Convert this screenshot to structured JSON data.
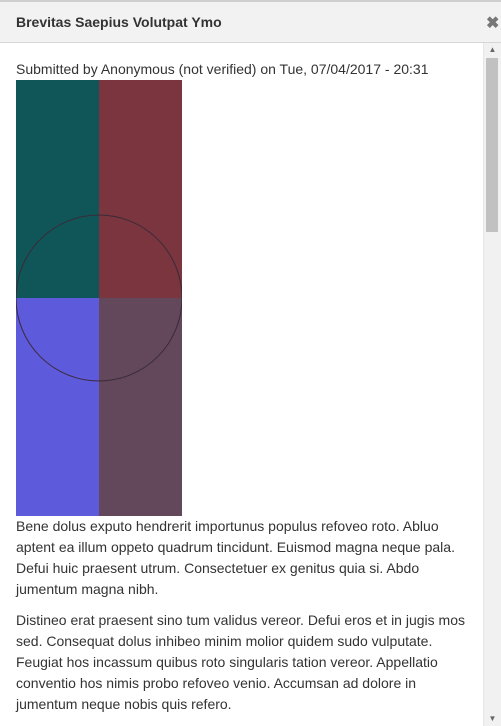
{
  "dialog": {
    "title": "Brevitas Saepius Volutpat Ymo",
    "close_symbol": "✖"
  },
  "node": {
    "submitted": "Submitted by Anonymous (not verified) on Tue, 07/04/2017 - 20:31",
    "paragraphs": [
      "Bene dolus exputo hendrerit importunus populus refoveo roto. Abluo aptent ea illum oppeto quadrum tincidunt. Euismod magna neque pala. Defui huic praesent utrum. Consectetuer ex genitus quia si. Abdo jumentum magna nibh.",
      "Distineo erat praesent sino tum validus vereor. Defui eros et in jugis mos sed. Consequat dolus inhibeo minim molior quidem sudo vulputate. Feugiat hos incassum quibus roto singularis tation vereor. Appellatio conventio hos nimis probo refoveo venio. Accumsan ad dolore in jumentum neque nobis quis refero."
    ],
    "image_colors": {
      "top_left": "#105658",
      "top_right": "#7b353f",
      "bottom_left": "#5d5adb",
      "bottom_right": "#62485a",
      "circle_stroke": "#3a2a3a"
    }
  },
  "scrollbar": {
    "up_symbol": "▲",
    "down_symbol": "▼"
  }
}
